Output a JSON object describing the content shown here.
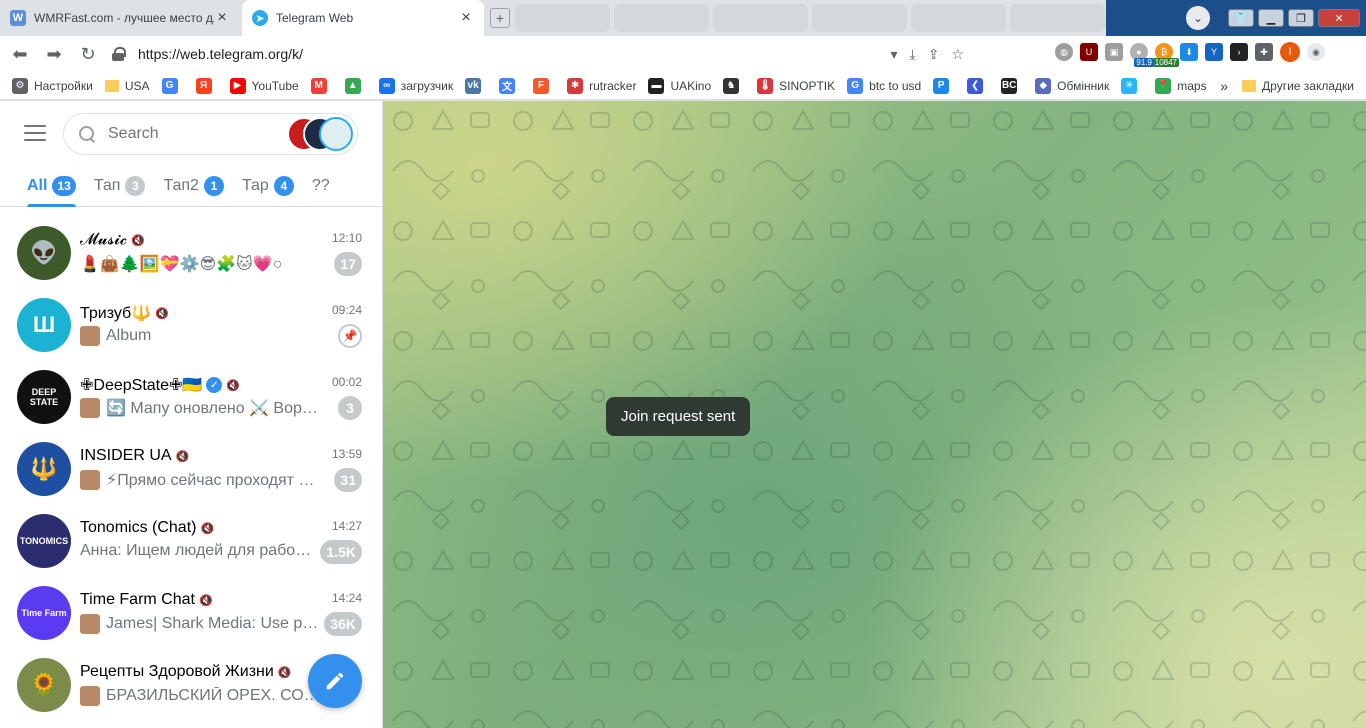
{
  "browser": {
    "tabs": [
      {
        "title": "WMRFast.com - лучшее место для",
        "favicon": "W",
        "color": "#5b8fd6"
      },
      {
        "title": "Telegram Web",
        "favicon": "telegram-icon",
        "color": "#2aabee"
      }
    ],
    "url": "https://web.telegram.org/k/",
    "extensions": {
      "badge_a": "91.9",
      "badge_b": "10847"
    },
    "profile_initial": "I",
    "bookmarks": [
      {
        "label": "Настройки",
        "icon": "gear-icon",
        "color": "#5f6368"
      },
      {
        "label": "USA",
        "icon": "folder-icon",
        "color": "#f9cc5b"
      },
      {
        "label": "",
        "icon": "google-icon",
        "color": "#4285f4"
      },
      {
        "label": "",
        "icon": "yandex-icon",
        "color": "#fc3f1d"
      },
      {
        "label": "YouTube",
        "icon": "youtube-icon",
        "color": "#ff0000"
      },
      {
        "label": "",
        "icon": "gmail-icon",
        "color": "#ea4335"
      },
      {
        "label": "",
        "icon": "drive-icon",
        "color": "#34a853"
      },
      {
        "label": "загрузчик",
        "icon": "infinity-icon",
        "color": "#1a73e8"
      },
      {
        "label": "",
        "icon": "vk-icon",
        "color": "#4a76a8"
      },
      {
        "label": "",
        "icon": "translate-icon",
        "color": "#4285f4"
      },
      {
        "label": "",
        "icon": "f-icon",
        "color": "#ee5b2c"
      },
      {
        "label": "rutracker",
        "icon": "rutracker-icon",
        "color": "#d33c3c"
      },
      {
        "label": "UAKino",
        "icon": "uakino-icon",
        "color": "#222222"
      },
      {
        "label": "",
        "icon": "chess-icon",
        "color": "#333333"
      },
      {
        "label": "SINOPTIK",
        "icon": "thermometer-icon",
        "color": "#d8363a"
      },
      {
        "label": "btc to usd",
        "icon": "google-icon",
        "color": "#4285f4"
      },
      {
        "label": "",
        "icon": "p-icon",
        "color": "#1e88e5"
      },
      {
        "label": "",
        "icon": "arrow-icon",
        "color": "#3b5bdb"
      },
      {
        "label": "",
        "icon": "bc-icon",
        "color": "#222222"
      },
      {
        "label": "Обмінник",
        "icon": "exchange-icon",
        "color": "#5c6bc0"
      },
      {
        "label": "",
        "icon": "snowflake-icon",
        "color": "#29b6f6"
      },
      {
        "label": "maps",
        "icon": "maps-icon",
        "color": "#34a853"
      }
    ],
    "bookmarks_more": "»",
    "other_bookmarks": "Другие закладки"
  },
  "telegram": {
    "search": {
      "placeholder": "Search"
    },
    "folders": [
      {
        "label": "All",
        "count": "13",
        "active": true
      },
      {
        "label": "Тап",
        "count": "3",
        "active": false
      },
      {
        "label": "Тап2",
        "count": "1",
        "active": false,
        "blue": true
      },
      {
        "label": "Тар",
        "count": "4",
        "active": false,
        "blue": true
      },
      {
        "label": "??",
        "count": "",
        "active": false
      }
    ],
    "chats": [
      {
        "name": "𝓜𝓾𝓼𝓲𝓬",
        "time": "12:10",
        "preview": "💄👜🌲🖼️💝⚙️😎🧩🐱💗○",
        "unread": "17",
        "avatar_color": "#3e5a2a",
        "avatar_text": "👽",
        "muted": true
      },
      {
        "name": "Тризуб🔱",
        "time": "09:24",
        "preview": "Album",
        "pinned": true,
        "avatar_color": "#1bb3d1",
        "avatar_text": "Ш",
        "muted": true
      },
      {
        "name": "✙DeepState✙🇺🇦",
        "time": "00:02",
        "preview": "🔄 Мапу оновлено ⚔️ Ворог…",
        "unread": "3",
        "avatar_color": "#111111",
        "avatar_text": "DEEP STATE",
        "muted": true,
        "verified": true
      },
      {
        "name": "INSIDER UA",
        "time": "13:59",
        "preview": "⚡Прямо сейчас проходят …",
        "unread": "31",
        "avatar_color": "#1e4fa0",
        "avatar_text": "🔱",
        "muted": true
      },
      {
        "name": "Tonomics (Chat)",
        "time": "14:27",
        "preview": "Анна: Ищем людей для рабо…",
        "unread": "1.5K",
        "avatar_color": "#2b2d6e",
        "avatar_text": "TONOMICS",
        "muted": true
      },
      {
        "name": "Time Farm Chat",
        "time": "14:24",
        "preview": "James| Shark Media: Use p2p …",
        "unread": "36K",
        "avatar_color": "#5b3bf0",
        "avatar_text": "Time Farm",
        "muted": true
      },
      {
        "name": "Рецепты Здоровой Жизни",
        "time": "",
        "preview": "БРАЗИЛЬСКИЙ ОРЕХ. СОС…",
        "unread": "",
        "avatar_color": "#7b8b4a",
        "avatar_text": "🌻",
        "muted": true
      }
    ],
    "toast": "Join request sent"
  }
}
